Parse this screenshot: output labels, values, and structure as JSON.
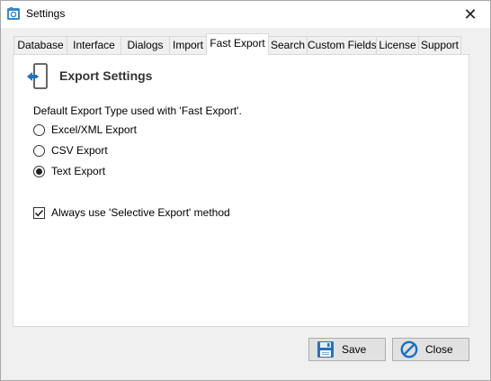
{
  "window": {
    "title": "Settings",
    "close_glyph": "✕"
  },
  "tabs": [
    {
      "label": "Database",
      "active": false
    },
    {
      "label": "Interface",
      "active": false
    },
    {
      "label": "Dialogs",
      "active": false
    },
    {
      "label": "Import",
      "active": false
    },
    {
      "label": "Fast Export",
      "active": true
    },
    {
      "label": "Search",
      "active": false
    },
    {
      "label": "Custom Fields",
      "active": false
    },
    {
      "label": "License",
      "active": false
    },
    {
      "label": "Support",
      "active": false
    }
  ],
  "section": {
    "title": "Export Settings",
    "icon": "export-door-icon",
    "description": "Default Export Type used with 'Fast Export'."
  },
  "export_types": {
    "selected": "Text Export",
    "options": [
      "Excel/XML Export",
      "CSV Export",
      "Text Export"
    ]
  },
  "selective_export": {
    "label": "Always use 'Selective Export' method",
    "checked": true
  },
  "buttons": {
    "save_label": "Save",
    "close_label": "Close"
  },
  "colors": {
    "accent_blue": "#1e73be",
    "close_icon_blue": "#1a6fc4"
  }
}
